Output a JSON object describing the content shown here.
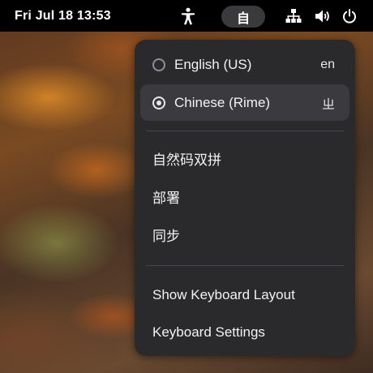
{
  "topbar": {
    "clock": "Fri Jul 18  13:53",
    "ime_indicator": "自",
    "icons": [
      "accessibility-icon",
      "network-icon",
      "volume-icon",
      "power-icon"
    ]
  },
  "menu": {
    "sources": [
      {
        "label": "English (US)",
        "short": "en",
        "selected": false
      },
      {
        "label": "Chinese (Rime)",
        "short": "ㄓ",
        "selected": true
      }
    ],
    "rime_options": [
      "自然码双拼",
      "部署",
      "同步"
    ],
    "actions": [
      "Show Keyboard Layout",
      "Keyboard Settings"
    ]
  },
  "colors": {
    "topbar": "#000000",
    "menu_bg": "#2a2a2d",
    "selected_bg": "#3b3b3f",
    "separator": "#45454a"
  }
}
